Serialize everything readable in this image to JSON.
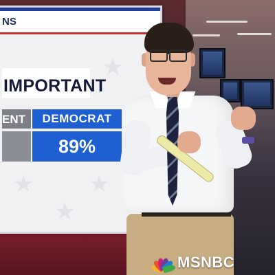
{
  "board": {
    "title_fragment": "NS",
    "heading": "IMPORTANT",
    "columns": [
      {
        "label": "ENT",
        "value": ""
      },
      {
        "label": "DEMOCRAT",
        "value": "89%"
      }
    ]
  },
  "logo": {
    "text": "MSNBC",
    "peacock_colors": [
      "#f5b335",
      "#e9532c",
      "#c8207e",
      "#6b3f98",
      "#1f7fd0",
      "#3eaa47"
    ]
  }
}
